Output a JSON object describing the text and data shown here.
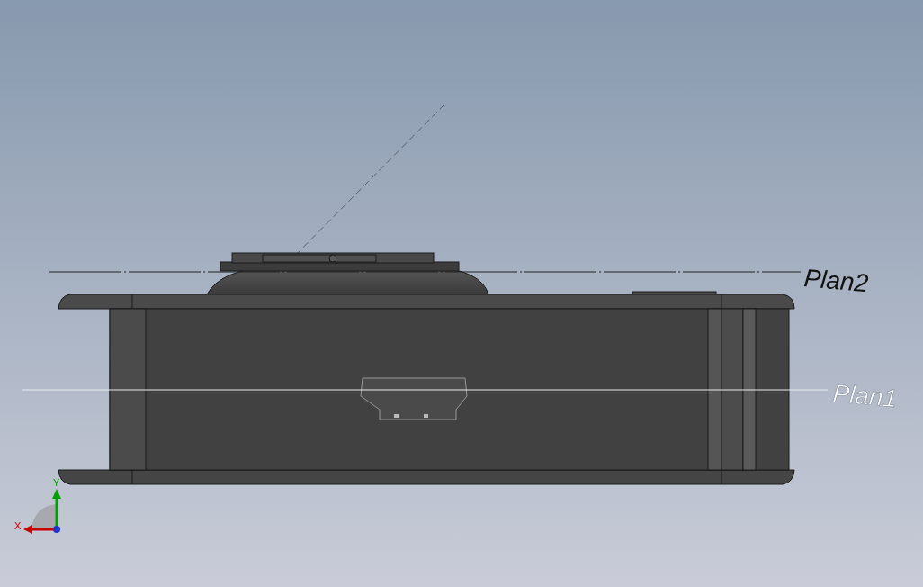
{
  "viewport": {
    "planes": [
      {
        "label": "Plan2",
        "dimmed": false
      },
      {
        "label": "Plan1",
        "dimmed": true
      }
    ]
  },
  "triad": {
    "axes": [
      {
        "label": "X",
        "color": "#cc0000"
      },
      {
        "label": "Y",
        "color": "#00a000"
      }
    ]
  }
}
